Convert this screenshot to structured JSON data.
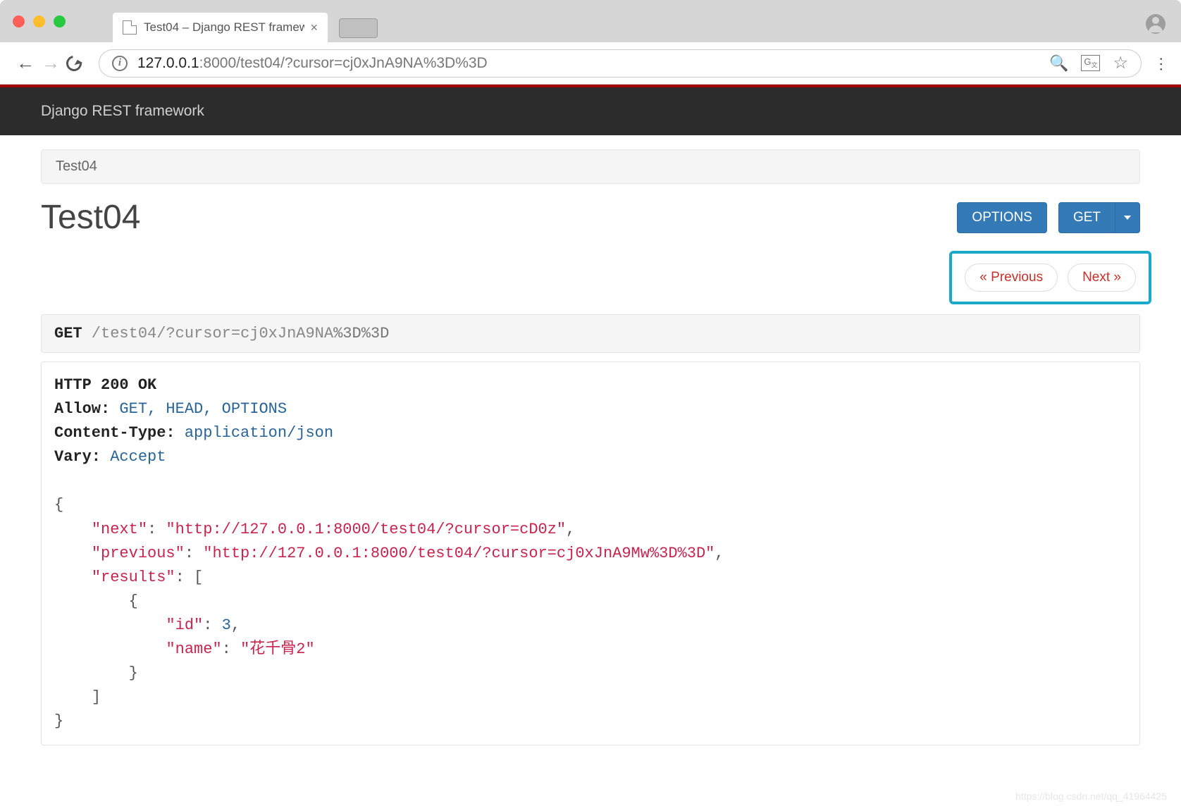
{
  "browser": {
    "tab_title": "Test04 – Django REST framew",
    "url_display_host": "127.0.0.1",
    "url_display_rest": ":8000/test04/?cursor=cj0xJnA9NA%3D%3D"
  },
  "navbar": {
    "brand": "Django REST framework"
  },
  "breadcrumb": "Test04",
  "page_title": "Test04",
  "buttons": {
    "options": "OPTIONS",
    "get": "GET"
  },
  "pagination": {
    "previous": "« Previous",
    "next": "Next »"
  },
  "request": {
    "method": "GET",
    "path_prefix": " /test04/",
    "query_key": "?cursor",
    "equals": "=",
    "cursor_part": "cj0xJnA9NA",
    "pct1": "%3D",
    "pct2": "%3D"
  },
  "response": {
    "status": "HTTP 200 OK",
    "allow_label": "Allow:",
    "allow_value": "GET, HEAD, OPTIONS",
    "ctype_label": "Content-Type:",
    "ctype_value": "application/json",
    "vary_label": "Vary:",
    "vary_value": "Accept"
  },
  "json_body": {
    "next_key": "\"next\"",
    "next_val": "\"http://127.0.0.1:8000/test04/?cursor=cD0z\"",
    "prev_key": "\"previous\"",
    "prev_val": "\"http://127.0.0.1:8000/test04/?cursor=cj0xJnA9Mw%3D%3D\"",
    "results_key": "\"results\"",
    "id_key": "\"id\"",
    "id_val": "3",
    "name_key": "\"name\"",
    "name_val": "\"花千骨2\""
  },
  "watermark": "https://blog.csdn.net/qq_41964425"
}
